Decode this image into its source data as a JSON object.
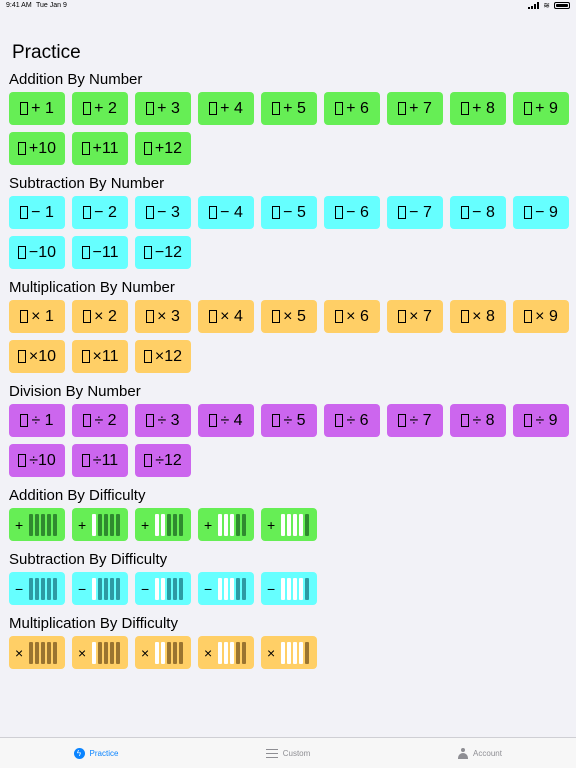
{
  "status": {
    "time": "9:41 AM",
    "date": "Tue Jan 9"
  },
  "title": "Practice",
  "sections": [
    {
      "title": "Addition By Number",
      "kind": "add",
      "tiles": [
        "+ 1",
        "+ 2",
        "+ 3",
        "+ 4",
        "+ 5",
        "+ 6",
        "+ 7",
        "+ 8",
        "+ 9",
        "+10",
        "+11",
        "+12"
      ]
    },
    {
      "title": "Subtraction By Number",
      "kind": "sub",
      "tiles": [
        "− 1",
        "− 2",
        "− 3",
        "− 4",
        "− 5",
        "− 6",
        "− 7",
        "− 8",
        "− 9",
        "−10",
        "−11",
        "−12"
      ]
    },
    {
      "title": "Multiplication By Number",
      "kind": "mul",
      "tiles": [
        "× 1",
        "× 2",
        "× 3",
        "× 4",
        "× 5",
        "× 6",
        "× 7",
        "× 8",
        "× 9",
        "×10",
        "×11",
        "×12"
      ]
    },
    {
      "title": "Division By Number",
      "kind": "div",
      "tiles": [
        "÷ 1",
        "÷ 2",
        "÷ 3",
        "÷ 4",
        "÷ 5",
        "÷ 6",
        "÷ 7",
        "÷ 8",
        "÷ 9",
        "÷10",
        "÷11",
        "÷12"
      ]
    },
    {
      "title": "Addition By Difficulty",
      "kind": "add",
      "op": "+",
      "difficulty": [
        5,
        4,
        3,
        2,
        1
      ]
    },
    {
      "title": "Subtraction By Difficulty",
      "kind": "sub",
      "op": "−",
      "difficulty": [
        5,
        4,
        3,
        2,
        1
      ]
    },
    {
      "title": "Multiplication By Difficulty",
      "kind": "mul",
      "op": "×",
      "difficulty": [
        5,
        4,
        3,
        2,
        1
      ]
    }
  ],
  "tabs": [
    {
      "label": "Practice",
      "icon": "bolt-icon",
      "active": true
    },
    {
      "label": "Custom",
      "icon": "sliders-icon",
      "active": false
    },
    {
      "label": "Account",
      "icon": "person-icon",
      "active": false
    }
  ]
}
